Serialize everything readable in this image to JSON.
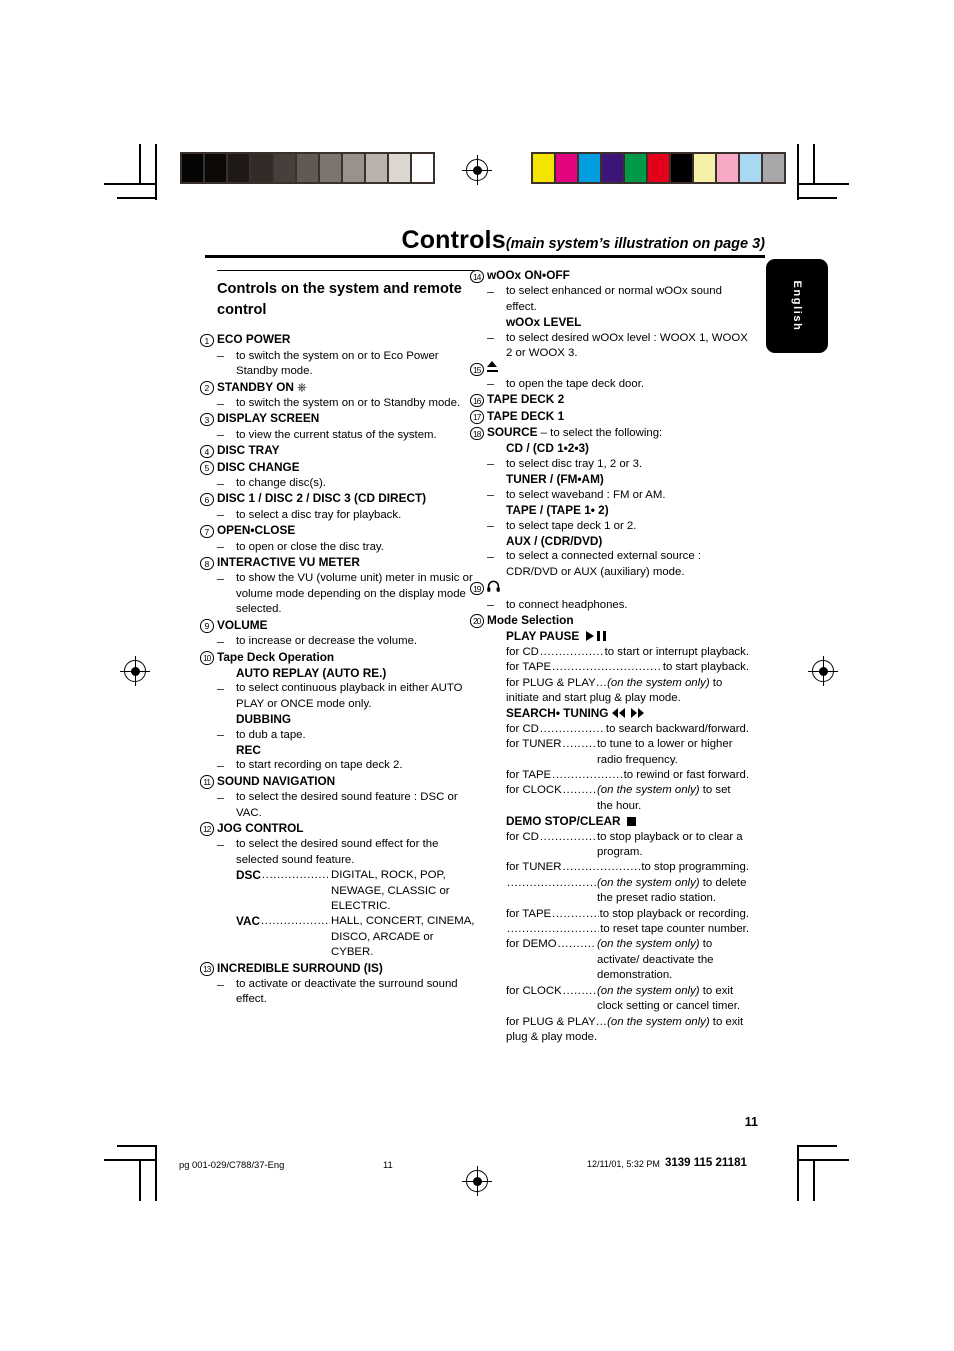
{
  "header": {
    "title": "Controls",
    "subtitle": "(main system’s illustration on page 3)",
    "language_tab": "English"
  },
  "calibration": {
    "gray_strip": [
      "#050505",
      "#0c0907",
      "#1f1a18",
      "#332b27",
      "#46403c",
      "#615953",
      "#7e746e",
      "#9b918b",
      "#bbb1ab",
      "#ddd7d2",
      "#ffffff"
    ],
    "color_strip": [
      "#f5e400",
      "#e2057f",
      "#009ee0",
      "#3d1478",
      "#009a49",
      "#e2001a",
      "#000000",
      "#f7f0a8",
      "#f7a8c4",
      "#a8d8f2",
      "#a8a8a8"
    ]
  },
  "left_column": {
    "section_title": "Controls on the system and remote control",
    "entries": [
      {
        "num": "1",
        "label": "ECO POWER",
        "desc": "to switch the system on or to Eco Power Standby mode."
      },
      {
        "num": "2",
        "label": "STANDBY ON",
        "symbol": "power-standby",
        "desc": "to switch the system on or to Standby mode."
      },
      {
        "num": "3",
        "label": "DISPLAY SCREEN",
        "desc": "to view the current status of the system."
      },
      {
        "num": "4",
        "label": "DISC TRAY"
      },
      {
        "num": "5",
        "label": "DISC CHANGE",
        "desc": "to change disc(s)."
      },
      {
        "num": "6",
        "label": "DISC 1 / DISC 2 / DISC 3 (CD DIRECT)",
        "desc": "to select a disc tray for playback."
      },
      {
        "num": "7",
        "label": "OPEN•CLOSE",
        "desc": "to open or close the disc tray."
      },
      {
        "num": "8",
        "label": "INTERACTIVE VU METER",
        "desc": "to show the VU (volume unit) meter in music or volume mode depending on the display mode selected."
      },
      {
        "num": "9",
        "label": "VOLUME",
        "desc": "to increase or decrease the volume."
      },
      {
        "num": "10",
        "label": "Tape Deck Operation",
        "sub": [
          {
            "label": "AUTO REPLAY (AUTO RE.)",
            "desc": "to select continuous playback in either AUTO PLAY or ONCE mode only."
          },
          {
            "label": "DUBBING",
            "desc": "to dub a tape."
          },
          {
            "label": "REC",
            "desc": "to start recording on tape deck 2."
          }
        ]
      },
      {
        "num": "11",
        "label": "SOUND NAVIGATION",
        "desc": "to select the desired sound feature : DSC or VAC."
      },
      {
        "num": "12",
        "label": "JOG CONTROL",
        "desc": "to select the desired sound effect for the selected sound feature.",
        "kv": [
          {
            "key": "DSC",
            "value": "DIGITAL, ROCK, POP, NEWAGE, CLASSIC or ELECTRIC."
          },
          {
            "key": "VAC",
            "value": "HALL, CONCERT, CINEMA, DISCO, ARCADE or CYBER."
          }
        ]
      },
      {
        "num": "13",
        "label": "INCREDIBLE SURROUND (IS)",
        "desc": "to activate or deactivate the surround sound effect."
      }
    ]
  },
  "right_column": {
    "entries": [
      {
        "num": "14",
        "label": "wOOx ON•OFF",
        "desc": "to select enhanced or normal wOOx sound effect.",
        "sub": [
          {
            "label": "wOOx LEVEL",
            "desc": "to select desired wOOx level : WOOX 1, WOOX 2 or WOOX 3."
          }
        ]
      },
      {
        "num": "15",
        "symbol": "eject-icon",
        "desc": "to open the tape deck door."
      },
      {
        "num": "16",
        "label": "TAPE DECK 2"
      },
      {
        "num": "17",
        "label": "TAPE DECK 1"
      },
      {
        "num": "18",
        "label": "SOURCE",
        "label_tail": " – to select the following:",
        "sub": [
          {
            "label": "CD / (CD 1•2•3)",
            "desc": "to select disc tray 1, 2 or 3."
          },
          {
            "label": "TUNER / (FM•AM)",
            "desc": "to select waveband : FM or AM."
          },
          {
            "label": "TAPE / (TAPE 1• 2)",
            "desc": "to select tape deck 1 or 2."
          },
          {
            "label": "AUX / (CDR/DVD)",
            "desc": "to select a connected external source : CDR/DVD or AUX (auxiliary) mode."
          }
        ]
      },
      {
        "num": "19",
        "symbol": "headphones-icon",
        "desc": "to connect headphones."
      },
      {
        "num": "20",
        "label": "Mode Selection",
        "modes": [
          {
            "name": "PLAY PAUSE",
            "glyphs": [
              "play-icon",
              "pause-icon"
            ],
            "rows": [
              {
                "key": "for CD",
                "value": "to start or interrupt playback."
              },
              {
                "key": "for TAPE",
                "value": "to start playback."
              },
              {
                "key": "for PLUG & PLAY…",
                "italic": "(on the system only)",
                "value": " to initiate and start plug & play mode.",
                "no_dots": true
              }
            ]
          },
          {
            "name": "SEARCH• TUNING",
            "glyphs": [
              "rewind-icon",
              "fast-forward-icon"
            ],
            "rows": [
              {
                "key": "for CD",
                "value": "to search backward/forward."
              },
              {
                "key": "for TUNER",
                "value": "to tune to a lower or higher radio frequency."
              },
              {
                "key": "for TAPE",
                "value": "to rewind or fast forward."
              },
              {
                "key": "for CLOCK",
                "italic": "(on the system only)",
                "value": " to set the hour."
              }
            ]
          },
          {
            "name": "DEMO STOP/CLEAR",
            "glyphs": [
              "stop-icon"
            ],
            "rows": [
              {
                "key": "for CD",
                "value": "to stop playback or to clear a program."
              },
              {
                "key": "for TUNER",
                "value": "to stop programming."
              },
              {
                "key": "",
                "italic": "(on the system only)",
                "value": " to delete the preset radio station."
              },
              {
                "key": "for TAPE",
                "value": "to stop playback or recording."
              },
              {
                "key": "",
                "value": "to reset tape counter number."
              },
              {
                "key": "for DEMO",
                "italic": "(on the system only)",
                "value": " to activate/ deactivate the demonstration."
              },
              {
                "key": "for CLOCK",
                "italic": "(on the system only)",
                "value": " to exit clock setting or cancel timer."
              },
              {
                "key": "for PLUG & PLAY…",
                "italic": "(on the system only)",
                "value": " to exit plug & play mode.",
                "no_dots": true
              }
            ]
          }
        ]
      }
    ]
  },
  "footer": {
    "page_number": "11",
    "file_ref": "pg 001-029/C788/37-Eng",
    "folio": "11",
    "timestamp": "12/11/01, 5:32 PM",
    "doc_code": "3139 115 21181"
  }
}
